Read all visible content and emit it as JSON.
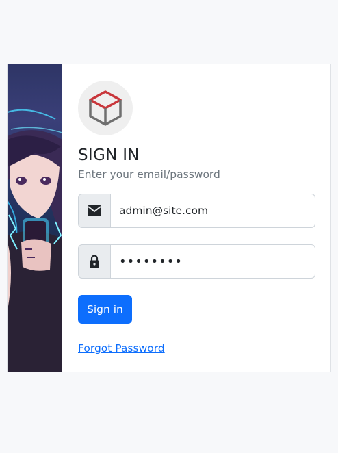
{
  "login": {
    "title": "SIGN IN",
    "subtitle": "Enter your email/password",
    "email": {
      "value": "admin@site.com",
      "icon": "envelope-icon"
    },
    "password": {
      "value": "••••••••",
      "icon": "lock-icon"
    },
    "submit_label": "Sign in",
    "forgot_label": "Forgot Password"
  },
  "colors": {
    "primary": "#0d6efd",
    "logo_top": "#c9363b",
    "logo_body": "#6f6f6f"
  }
}
